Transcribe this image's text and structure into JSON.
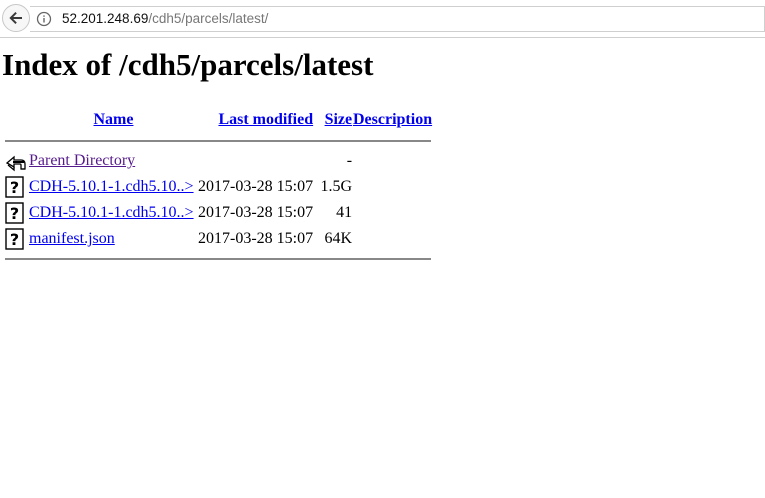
{
  "browser": {
    "url_host": "52.201.248.69",
    "url_path": "/cdh5/parcels/latest/"
  },
  "page": {
    "title": "Index of /cdh5/parcels/latest"
  },
  "columns": {
    "name": "Name",
    "last_modified": "Last modified",
    "size": "Size",
    "description": "Description"
  },
  "rows": [
    {
      "name": "Parent Directory",
      "modified": "",
      "size": "-",
      "description": "",
      "icon": "parent-directory-icon"
    },
    {
      "name": "CDH-5.10.1-1.cdh5.10..>",
      "modified": "2017-03-28 15:07",
      "size": "1.5G",
      "description": "",
      "icon": "unknown-file-icon"
    },
    {
      "name": "CDH-5.10.1-1.cdh5.10..>",
      "modified": "2017-03-28 15:07",
      "size": "41",
      "description": "",
      "icon": "unknown-file-icon"
    },
    {
      "name": "manifest.json",
      "modified": "2017-03-28 15:07",
      "size": "64K",
      "description": "",
      "icon": "unknown-file-icon"
    }
  ]
}
